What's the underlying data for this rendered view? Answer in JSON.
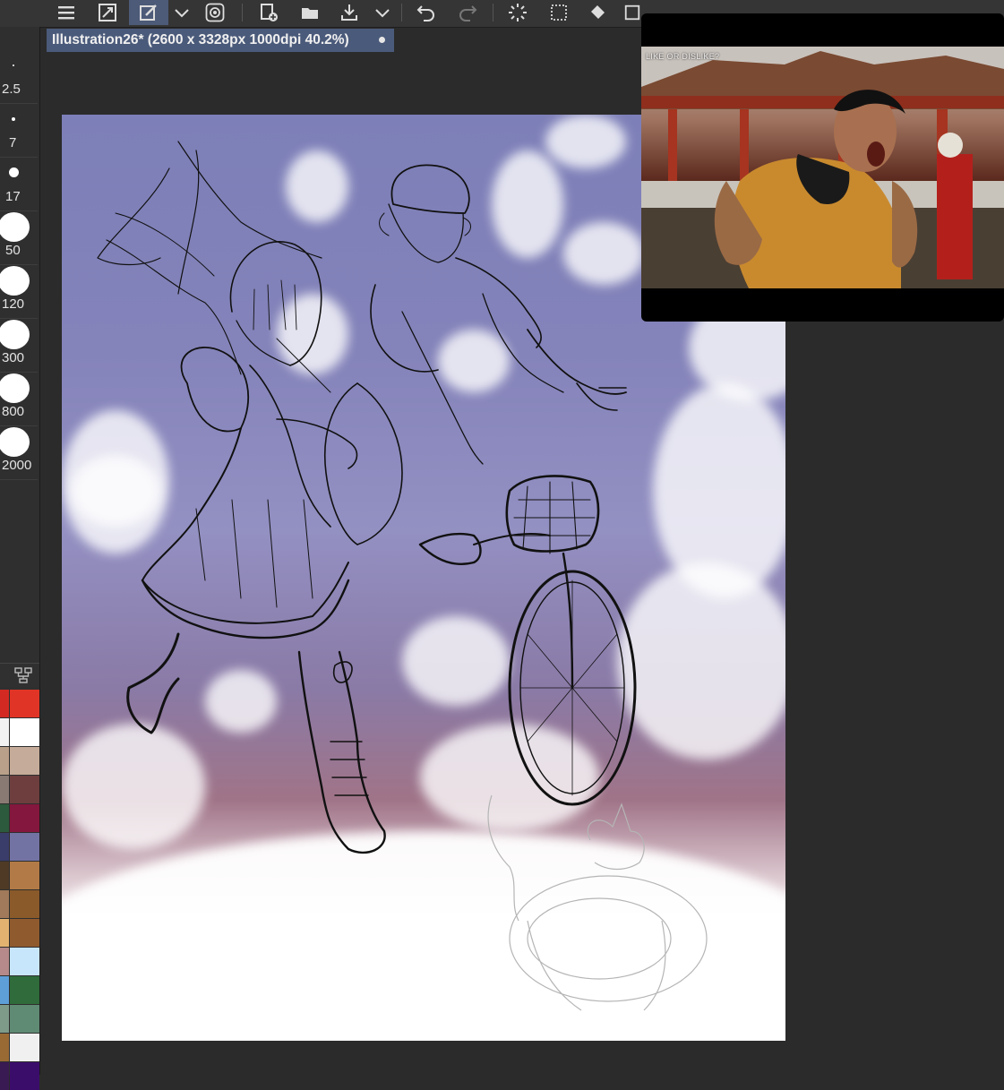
{
  "app": {
    "document_tab": "Illustration26* (2600 x 3328px 1000dpi 40.2%)"
  },
  "toolbar": {
    "icons": [
      "menu-icon",
      "resize-icon",
      "pen-edit-icon",
      "chevron-down-icon",
      "spiral-icon",
      "new-file-icon",
      "open-folder-icon",
      "export-icon",
      "chevron-down-icon",
      "undo-icon",
      "redo-icon",
      "loading-icon",
      "lasso-select-icon",
      "fill-icon",
      "transform-icon"
    ]
  },
  "brush_sizes": [
    {
      "label": "2.5"
    },
    {
      "label": "7"
    },
    {
      "label": "17"
    },
    {
      "label": "50"
    },
    {
      "label": "120"
    },
    {
      "label": "300"
    },
    {
      "label": "800"
    },
    {
      "label": "2000"
    }
  ],
  "palette": {
    "colors": [
      "#d22a22",
      "#e03526",
      "#f2f2f2",
      "#ffffff",
      "#b9a08a",
      "#c5ab99",
      "#8a7a74",
      "#6e3e3e",
      "#2c5a3c",
      "#84173d",
      "#3a3c6a",
      "#7373a3",
      "#4f3a26",
      "#b27a46",
      "#a07a5a",
      "#8a5a2a",
      "#e2b370",
      "#8f5a2e",
      "#b68a8a",
      "#c8e6fb",
      "#5e9fd8",
      "#2f6b3b",
      "#7e9b8a",
      "#5f8a74",
      "#9a6a35",
      "#f0f0f0",
      "#3a1a52",
      "#3b0d6b"
    ]
  },
  "video_overlay": {
    "caption": "LIKE OR DISLIKE?"
  }
}
